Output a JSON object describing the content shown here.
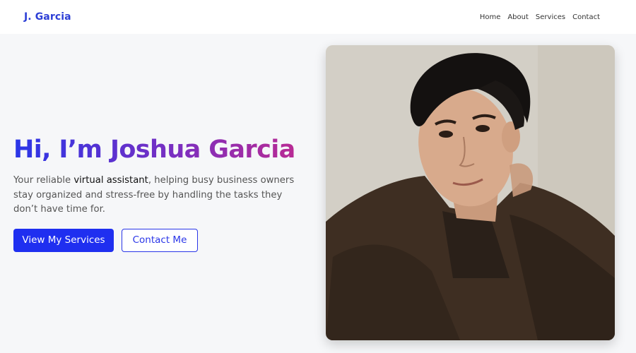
{
  "header": {
    "brand": "J. Garcia",
    "nav": [
      {
        "label": "Home"
      },
      {
        "label": "About"
      },
      {
        "label": "Services"
      },
      {
        "label": "Contact"
      }
    ]
  },
  "hero": {
    "title": "Hi, I’m Joshua Garcia",
    "description_before": "Your reliable ",
    "description_emphasis": "virtual assistant",
    "description_after": ", helping busy business owners stay organized and stress-free by handling the tasks they don’t have time for.",
    "primary_button": "View My Services",
    "secondary_button": "Contact Me",
    "colors": {
      "gradient_start": "#2a36e8",
      "gradient_mid": "#7b2fc0",
      "gradient_end": "#c02a8f",
      "primary": "#1f2ff0",
      "brand": "#2d3fd6"
    }
  }
}
